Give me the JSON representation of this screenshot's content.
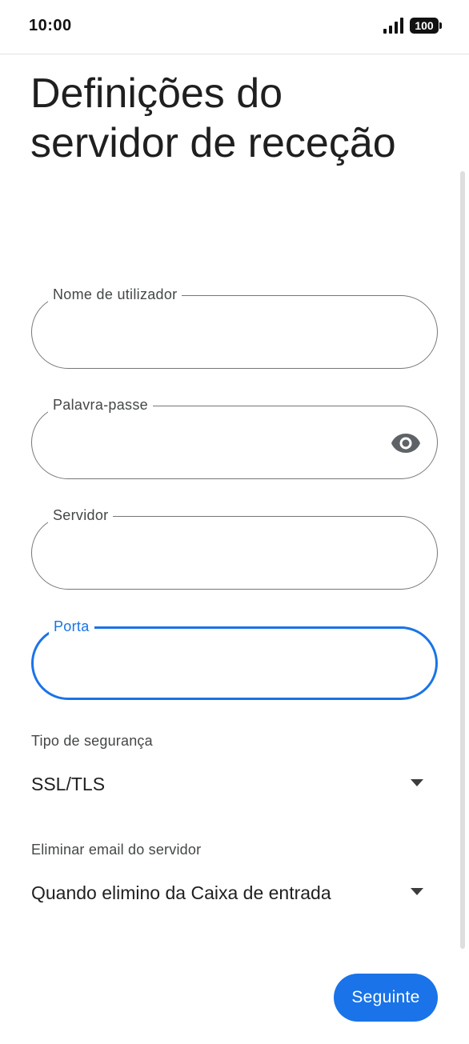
{
  "status_bar": {
    "time": "10:00",
    "battery": "100",
    "signal_icon": "cellular-signal-icon",
    "battery_icon": "battery-icon"
  },
  "page": {
    "title": "Definições do servidor de receção"
  },
  "fields": {
    "username": {
      "label": "Nome de utilizador",
      "value": ""
    },
    "password": {
      "label": "Palavra-passe",
      "value": "",
      "toggle_icon": "eye-icon"
    },
    "server": {
      "label": "Servidor",
      "value": ""
    },
    "port": {
      "label": "Porta",
      "value": ""
    }
  },
  "security": {
    "label": "Tipo de segurança",
    "selected": "SSL/TLS",
    "arrow_icon": "dropdown-arrow-icon"
  },
  "delete_from_server": {
    "label": "Eliminar email do servidor",
    "selected": "Quando elimino da Caixa de entrada",
    "arrow_icon": "dropdown-arrow-icon"
  },
  "actions": {
    "next_label": "Seguinte"
  },
  "colors": {
    "accent": "#1a73e8",
    "outline": "#747775",
    "text": "#1f1f1f"
  }
}
